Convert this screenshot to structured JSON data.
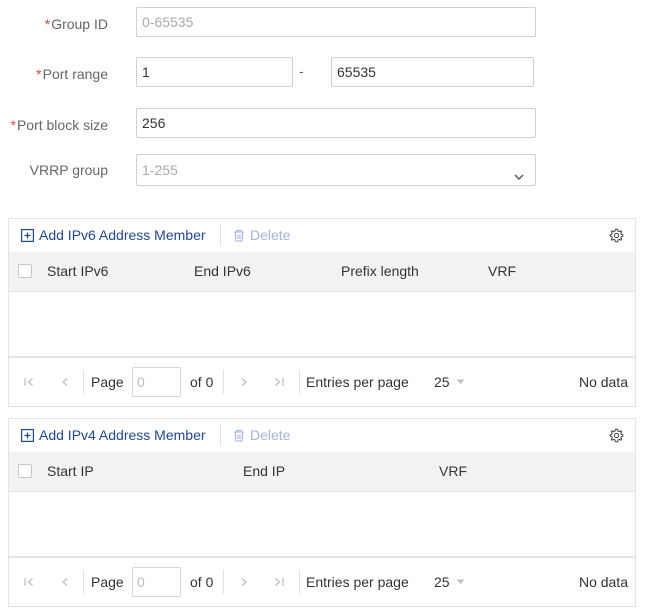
{
  "form": {
    "required_mark": "*",
    "group_id": {
      "label": "Group ID",
      "placeholder": "0-65535"
    },
    "port_range": {
      "label": "Port range",
      "start": "1",
      "separator": "-",
      "end": "65535"
    },
    "port_block_size": {
      "label": "Port block size",
      "value": "256"
    },
    "vrrp_group": {
      "label": "VRRP group",
      "placeholder": "1-255"
    }
  },
  "ipv6_table": {
    "add_label": "Add IPv6 Address Member",
    "delete_label": "Delete",
    "columns": [
      "Start IPv6",
      "End IPv6",
      "Prefix length",
      "VRF"
    ],
    "rows": []
  },
  "ipv4_table": {
    "add_label": "Add IPv4 Address Member",
    "delete_label": "Delete",
    "columns": [
      "Start IP",
      "End IP",
      "VRF"
    ],
    "rows": []
  },
  "pager_ipv6": {
    "page_label": "Page",
    "page_placeholder": "0",
    "of_label": "of 0",
    "entries_label": "Entries per page",
    "per_page": "25",
    "status": "No data"
  },
  "pager_ipv4": {
    "page_label": "Page",
    "page_placeholder": "0",
    "of_label": "of 0",
    "entries_label": "Entries per page",
    "per_page": "25",
    "status": "No data"
  },
  "icons": {
    "add": "plus-square-icon",
    "delete": "trash-icon",
    "settings": "gear-icon",
    "first": "first-page-icon",
    "prev": "prev-page-icon",
    "next": "next-page-icon",
    "last": "last-page-icon",
    "caret": "caret-down-icon",
    "chevron": "chevron-down-icon"
  },
  "colors": {
    "accent": "#1d47a8",
    "required": "#e0443e",
    "disabled_link": "#a4b4e0",
    "header_bg": "#f2f2f2"
  }
}
